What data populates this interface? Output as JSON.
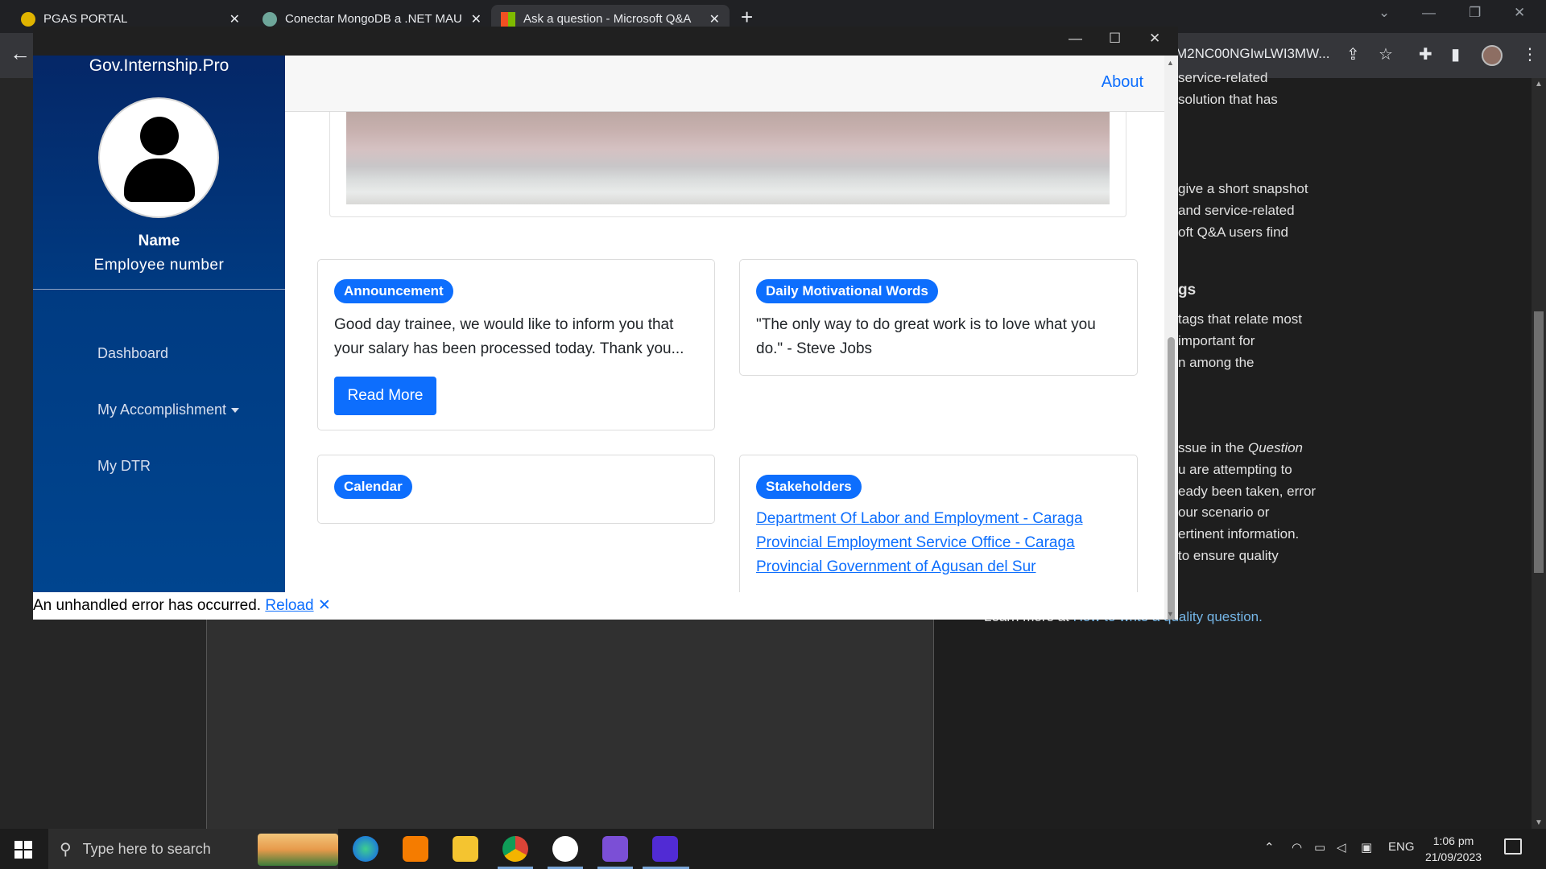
{
  "browser": {
    "tabs": [
      {
        "title": "PGAS PORTAL",
        "icon": "pgas-icon"
      },
      {
        "title": "Conectar MongoDB a .NET MAUI",
        "icon": "chatgpt-icon"
      },
      {
        "title": "Ask a question - Microsoft Q&A",
        "icon": "microsoft-icon"
      }
    ],
    "url_tail": "M2NC00NGIwLWI3MW..."
  },
  "background_page": {
    "lines": [
      "service-related",
      "solution that has",
      "give a short snapshot",
      "and service-related",
      "oft Q&A users find",
      "gs",
      "tags that relate most",
      "important for",
      "n among the",
      "ssue in the",
      "Question",
      "u are attempting to",
      "eady been taken, error",
      "our scenario or",
      "ertinent information.",
      "to ensure quality",
      "Learn more at",
      "How to write a quality question."
    ]
  },
  "app": {
    "brand": "Gov.Internship.Pro",
    "profile": {
      "name": "Name",
      "employee_number": "Employee number"
    },
    "nav": [
      "Dashboard",
      "My Accomplishment",
      "My DTR"
    ],
    "topbar_link": "About",
    "cards": {
      "announcement": {
        "badge": "Announcement",
        "text_line1": "Good day trainee, we would like to inform you that",
        "text_line2": "your salary has been processed today. Thank you...",
        "button": "Read More"
      },
      "motivation": {
        "badge": "Daily Motivational Words",
        "text_line1": "\"The only way to do great work is to love what you",
        "text_line2": "do.\" - Steve Jobs"
      },
      "calendar": {
        "badge": "Calendar"
      },
      "stakeholders": {
        "badge": "Stakeholders",
        "links": [
          "Department Of Labor and Employment - Caraga",
          "Provincial Employment Service Office - Caraga",
          "Provincial Government of Agusan del Sur"
        ]
      }
    },
    "error_bar": {
      "message": "An unhandled error has occurred.",
      "reload": "Reload",
      "dismiss": "✕"
    }
  },
  "taskbar": {
    "search_placeholder": "Type here to search",
    "tray": {
      "language": "ENG",
      "time": "1:06 pm",
      "date": "21/09/2023"
    }
  },
  "colors": {
    "primary": "#0d6efd",
    "sidebar_top": "#052767",
    "sidebar_bottom": "#00458f"
  }
}
